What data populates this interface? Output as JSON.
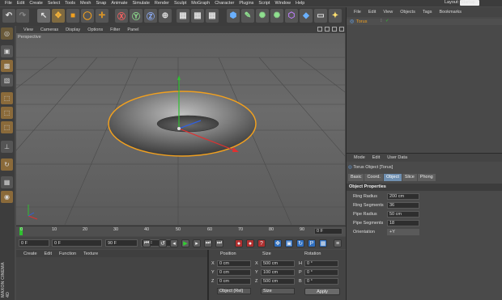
{
  "menubar": {
    "items": [
      "File",
      "Edit",
      "Create",
      "Select",
      "Tools",
      "Mesh",
      "Snap",
      "Animate",
      "Simulate",
      "Render",
      "Sculpt",
      "MoGraph",
      "Character",
      "Plugins",
      "Script",
      "Window",
      "Help"
    ],
    "layout_label": "Layout:",
    "layout_value": "Startup"
  },
  "viewport": {
    "menu": [
      "View",
      "Cameras",
      "Display",
      "Options",
      "Filter",
      "Panel"
    ],
    "camera_label": "Perspective"
  },
  "timeline": {
    "ticks": [
      "0",
      "10",
      "20",
      "30",
      "40",
      "50",
      "60",
      "70",
      "80",
      "90"
    ],
    "current_frame": "0 F"
  },
  "transport": {
    "start_frame": "0 F",
    "preview_min": "0 F",
    "preview_max": "90 F",
    "end_frame": "90 F"
  },
  "material_manager": {
    "menu": [
      "Create",
      "Edit",
      "Function",
      "Texture"
    ]
  },
  "coordinates": {
    "headers": [
      "Position",
      "Size",
      "Rotation"
    ],
    "rows": [
      {
        "axis": "X",
        "pos": "0 cm",
        "size_axis": "X",
        "size": "500 cm",
        "rot_axis": "H",
        "rot": "0 °"
      },
      {
        "axis": "Y",
        "pos": "0 cm",
        "size_axis": "Y",
        "size": "100 cm",
        "rot_axis": "P",
        "rot": "0 °"
      },
      {
        "axis": "Z",
        "pos": "0 cm",
        "size_axis": "Z",
        "size": "500 cm",
        "rot_axis": "B",
        "rot": "0 °"
      }
    ],
    "mode_dropdown": "Object (Rel)",
    "size_dropdown": "Size",
    "apply_label": "Apply"
  },
  "object_manager": {
    "menu": [
      "File",
      "Edit",
      "View",
      "Objects",
      "Tags",
      "Bookmarks"
    ],
    "objects": [
      {
        "name": "Torus"
      }
    ]
  },
  "attribute_manager": {
    "menu": [
      "Mode",
      "Edit",
      "User Data"
    ],
    "title": "Torus Object [Torus]",
    "tabs": [
      "Basic",
      "Coord.",
      "Object",
      "Slice",
      "Phong"
    ],
    "active_tab": "Object",
    "section": "Object Properties",
    "properties": [
      {
        "label": "Ring Radius",
        "value": "200 cm"
      },
      {
        "label": "Ring Segments",
        "value": "36"
      },
      {
        "label": "Pipe Radius",
        "value": "50 cm"
      },
      {
        "label": "Pipe Segments",
        "value": "18"
      },
      {
        "label": "Orientation",
        "value": "+Y"
      }
    ]
  },
  "branding": {
    "vertical_text": "MAXON CINEMA 4D"
  },
  "colors": {
    "accent": "#f0a020",
    "selection": "#6f8fb0",
    "axis_x": "#e03030",
    "axis_y": "#30c030",
    "axis_z": "#3060e0"
  }
}
